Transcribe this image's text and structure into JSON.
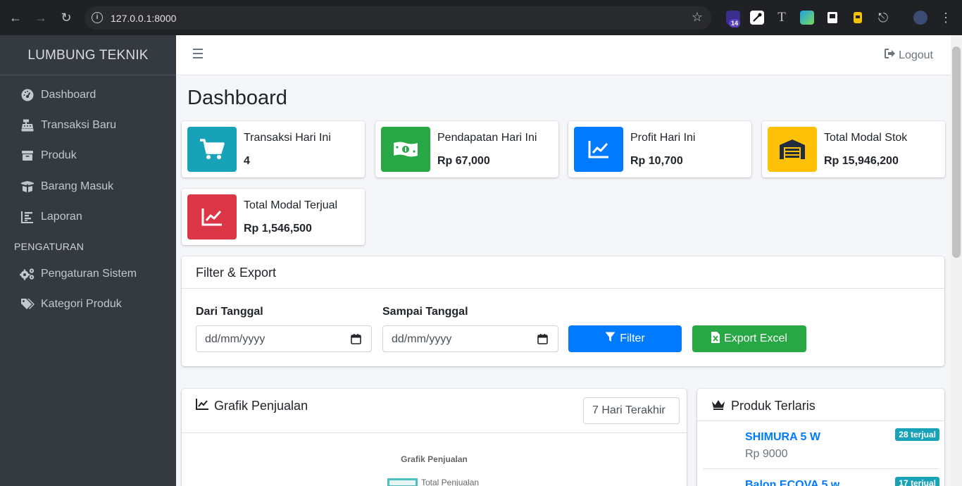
{
  "browser": {
    "url": "127.0.0.1:8000",
    "extension_badge": "14"
  },
  "sidebar": {
    "brand": "LUMBUNG TEKNIK",
    "items": [
      {
        "label": "Dashboard",
        "icon": "tachometer-icon"
      },
      {
        "label": "Transaksi Baru",
        "icon": "cash-register-icon"
      },
      {
        "label": "Produk",
        "icon": "box-icon"
      },
      {
        "label": "Barang Masuk",
        "icon": "box-open-icon"
      },
      {
        "label": "Laporan",
        "icon": "chart-bar-icon"
      }
    ],
    "section_header": "PENGATURAN",
    "settings_items": [
      {
        "label": "Pengaturan Sistem",
        "icon": "cogs-icon"
      },
      {
        "label": "Kategori Produk",
        "icon": "tags-icon"
      }
    ]
  },
  "topbar": {
    "logout_label": "Logout"
  },
  "page": {
    "title": "Dashboard"
  },
  "stats": [
    {
      "label": "Transaksi Hari Ini",
      "value": "4",
      "color": "#17a2b8",
      "icon": "shopping-cart-icon"
    },
    {
      "label": "Pendapatan Hari Ini",
      "value": "Rp 67,000",
      "color": "#28a745",
      "icon": "money-bill-icon"
    },
    {
      "label": "Profit Hari Ini",
      "value": "Rp 10,700",
      "color": "#007bff",
      "icon": "chart-line-icon"
    },
    {
      "label": "Total Modal Stok",
      "value": "Rp 15,946,200",
      "color": "#ffc107",
      "icon": "warehouse-icon"
    },
    {
      "label": "Total Modal Terjual",
      "value": "Rp 1,546,500",
      "color": "#dc3545",
      "icon": "chart-line-icon"
    }
  ],
  "filter": {
    "title": "Filter & Export",
    "from_label": "Dari Tanggal",
    "to_label": "Sampai Tanggal",
    "date_placeholder": "dd/mm/yyyy",
    "filter_button": "Filter",
    "export_button": "Export Excel"
  },
  "sales_chart": {
    "title": "Grafik Penjualan",
    "range_selected": "7 Hari Terakhir"
  },
  "chart_data": {
    "type": "line",
    "title": "Grafik Penjualan",
    "series": [
      {
        "name": "Total Penjualan",
        "values": []
      }
    ],
    "legend": "top"
  },
  "top_products": {
    "title": "Produk Terlaris",
    "items": [
      {
        "name": "SHIMURA 5 W",
        "price": "Rp 9000",
        "badge": "28 terjual"
      },
      {
        "name": "Balon ECOVA 5 w",
        "price": "",
        "badge": "17 terjual"
      }
    ]
  }
}
